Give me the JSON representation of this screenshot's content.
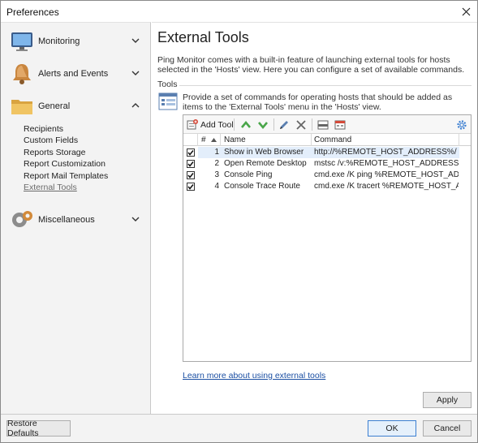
{
  "window": {
    "title": "Preferences"
  },
  "sidebar": {
    "groups": [
      {
        "label": "Monitoring",
        "icon": "monitor-icon"
      },
      {
        "label": "Alerts and Events",
        "icon": "bell-icon"
      },
      {
        "label": "General",
        "icon": "folder-icon",
        "expanded": true
      },
      {
        "label": "Miscellaneous",
        "icon": "gears-icon"
      }
    ],
    "general_items": [
      {
        "label": "Recipients"
      },
      {
        "label": "Custom Fields"
      },
      {
        "label": "Reports Storage"
      },
      {
        "label": "Report Customization"
      },
      {
        "label": "Report Mail Templates"
      },
      {
        "label": "External Tools",
        "active": true
      }
    ]
  },
  "main": {
    "title": "External Tools",
    "description": "Ping Monitor comes with a built-in feature of launching external tools for hosts selected in the 'Hosts' view. Here you can configure a set of available commands.",
    "section_label": "Tools",
    "tools_description": "Provide a set of commands for operating hosts that should be added as items to the 'External Tools' menu in the 'Hosts' view.",
    "toolbar": {
      "add_label": "Add Tool"
    },
    "table": {
      "headers": {
        "num": "#",
        "name": "Name",
        "command": "Command"
      },
      "rows": [
        {
          "checked": true,
          "num": "1",
          "name": "Show in Web Browser",
          "command": "http://%REMOTE_HOST_ADDRESS%/",
          "selected": true
        },
        {
          "checked": true,
          "num": "2",
          "name": "Open Remote Desktop",
          "command": "mstsc /v:%REMOTE_HOST_ADDRESS%"
        },
        {
          "checked": true,
          "num": "3",
          "name": "Console Ping",
          "command": "cmd.exe /K ping %REMOTE_HOST_ADDRE..."
        },
        {
          "checked": true,
          "num": "4",
          "name": "Console Trace Route",
          "command": "cmd.exe /K tracert %REMOTE_HOST_ADD..."
        }
      ]
    },
    "learn_more": "Learn more about using external tools",
    "apply_label": "Apply"
  },
  "footer": {
    "restore_label": "Restore Defaults",
    "ok_label": "OK",
    "cancel_label": "Cancel"
  },
  "colors": {
    "accent": "#3c7fd1",
    "link": "#1b4fa3",
    "selection": "#e3eefb",
    "green": "#4aa64a"
  }
}
